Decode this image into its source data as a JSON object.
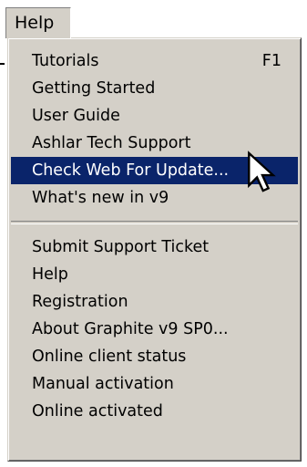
{
  "menubar": {
    "help_label": "Help"
  },
  "help_menu": {
    "group1": [
      {
        "label": "Tutorials",
        "shortcut": "F1"
      },
      {
        "label": "Getting Started"
      },
      {
        "label": "User Guide"
      },
      {
        "label": "Ashlar Tech Support"
      },
      {
        "label": "Check Web For Update...",
        "state": "highlighted"
      },
      {
        "label": "What's new in v9"
      }
    ],
    "group2": [
      {
        "label": "Submit Support Ticket"
      },
      {
        "label": "Help"
      },
      {
        "label": "Registration"
      },
      {
        "label": "About Graphite v9 SP0..."
      },
      {
        "label": "Online client status"
      },
      {
        "label": "Manual activation"
      },
      {
        "label": "Online activated"
      }
    ]
  },
  "colors": {
    "menu_background": "#d4d0c8",
    "highlight_background": "#0a246a",
    "highlight_text": "#ffffff"
  },
  "icons": {
    "cursor": "arrow-cursor-icon"
  }
}
